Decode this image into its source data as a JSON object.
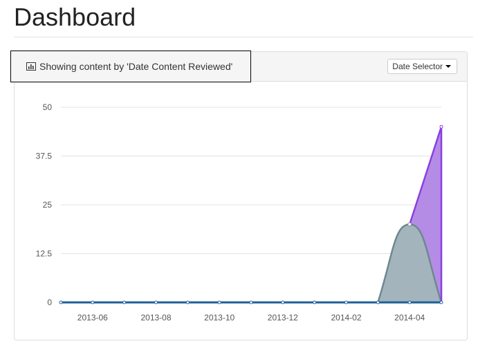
{
  "page": {
    "title": "Dashboard"
  },
  "panel": {
    "heading_icon": "bar-chart-icon",
    "heading_text": "Showing content by 'Date Content Reviewed'",
    "date_selector_label": "Date Selector",
    "date_selector_icon": "caret-down-icon"
  },
  "colors": {
    "purple_area": "#b48ce6",
    "purple_line": "#8a3fe0",
    "gray_area": "#a4b4bc",
    "gray_line": "#6f8790",
    "baseline": "#1e5f99",
    "grid": "#e3e3e3"
  },
  "chart_data": {
    "type": "area",
    "title": "",
    "xlabel": "",
    "ylabel": "",
    "x": [
      "2013-05",
      "2013-06",
      "2013-07",
      "2013-08",
      "2013-09",
      "2013-10",
      "2013-11",
      "2013-12",
      "2014-01",
      "2014-02",
      "2014-03",
      "2014-04",
      "2014-05"
    ],
    "x_tick_labels": [
      "2013-06",
      "2013-08",
      "2013-10",
      "2013-12",
      "2014-02",
      "2014-04"
    ],
    "y_ticks": [
      "0",
      "12.5",
      "25",
      "37.5",
      "50"
    ],
    "ylim": [
      0,
      50
    ],
    "grid": true,
    "series": [
      {
        "values": [
          0,
          0,
          0,
          0,
          0,
          0,
          0,
          0,
          0,
          0,
          0,
          0,
          0
        ]
      },
      {
        "values": [
          0,
          0,
          0,
          0,
          0,
          0,
          0,
          0,
          0,
          0,
          0,
          20,
          0
        ]
      },
      {
        "values": [
          0,
          0,
          0,
          0,
          0,
          0,
          0,
          0,
          0,
          0,
          0,
          20,
          45
        ]
      }
    ]
  }
}
